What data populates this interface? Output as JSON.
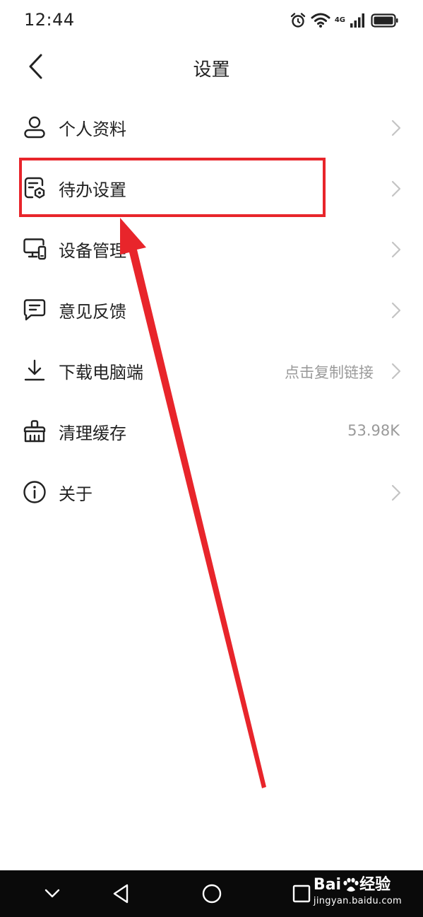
{
  "status_bar": {
    "time": "12:44",
    "network": "4G",
    "icons": [
      "alarm-icon",
      "wifi-icon",
      "cellular-signal-icon",
      "battery-icon"
    ]
  },
  "header": {
    "title": "设置",
    "back_icon": "chevron-left-icon"
  },
  "settings": {
    "items": [
      {
        "label": "个人资料",
        "icon": "person-icon",
        "value": "",
        "chevron": true
      },
      {
        "label": "待办设置",
        "icon": "todo-settings-icon",
        "value": "",
        "chevron": true
      },
      {
        "label": "设备管理",
        "icon": "devices-icon",
        "value": "",
        "chevron": true
      },
      {
        "label": "意见反馈",
        "icon": "feedback-icon",
        "value": "",
        "chevron": true
      },
      {
        "label": "下载电脑端",
        "icon": "download-icon",
        "value": "点击复制链接",
        "chevron": true
      },
      {
        "label": "清理缓存",
        "icon": "broom-icon",
        "value": "53.98K",
        "chevron": false
      },
      {
        "label": "关于",
        "icon": "info-icon",
        "value": "",
        "chevron": true
      }
    ]
  },
  "annotation": {
    "highlight_color": "#e8252b",
    "highlighted_item": "待办设置"
  },
  "nav_bar": {
    "buttons": [
      "chevron-down-icon",
      "back-triangle-icon",
      "home-circle-icon",
      "recents-square-icon"
    ]
  },
  "watermark": {
    "logo_prefix": "Bai",
    "logo_suffix": "经验",
    "url": "jingyan.baidu.com"
  },
  "colors": {
    "text": "#222222",
    "secondary_text": "#9a9a9a",
    "chevron": "#c4c4c4",
    "nav_bar": "#0a0a0a",
    "annotation_red": "#e8252b"
  }
}
